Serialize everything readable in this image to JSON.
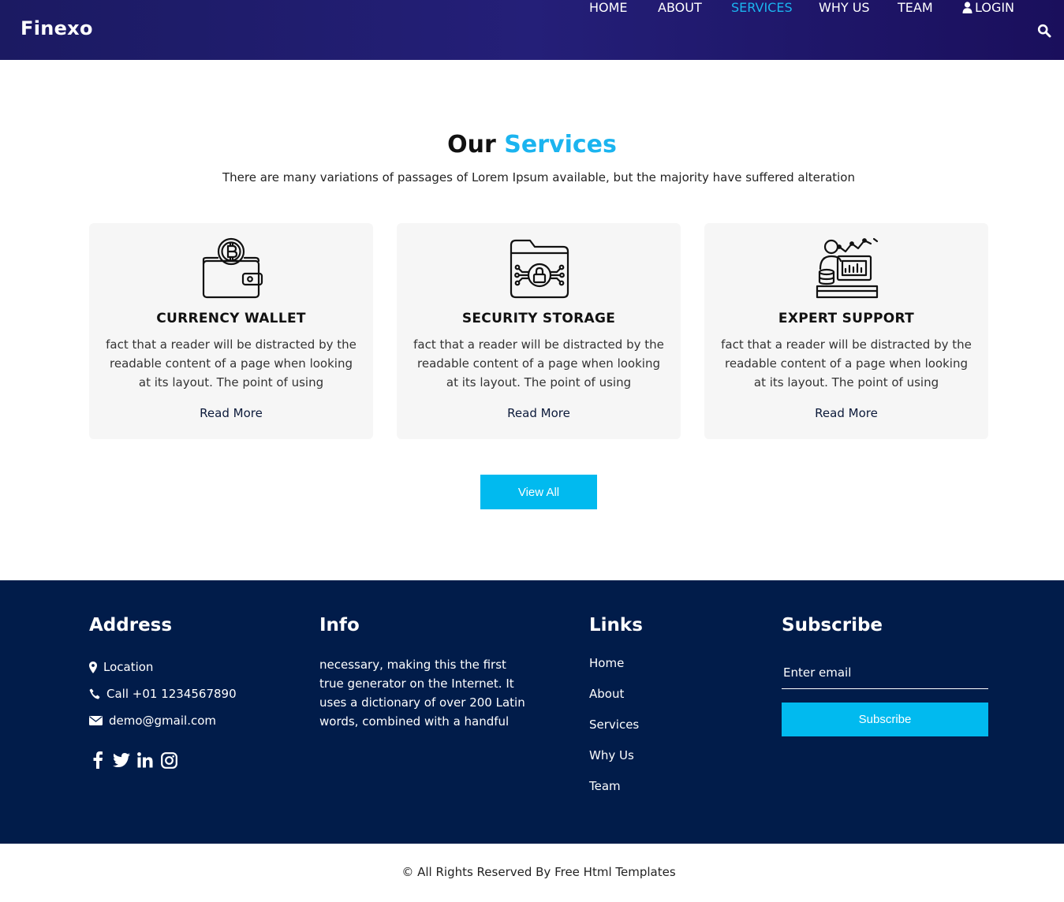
{
  "header": {
    "brand": "Finexo",
    "nav": [
      "HOME",
      "ABOUT",
      "SERVICES",
      "WHY US",
      "TEAM"
    ],
    "login_label": "LOGIN",
    "active": "SERVICES",
    "icons": {
      "login": "user-icon",
      "search": "search-icon"
    }
  },
  "services": {
    "title_part1": "Our",
    "title_part2": "Services",
    "subtitle": "There are many variations of passages of Lorem Ipsum available, but the majority have suffered alteration",
    "cards": [
      {
        "icon": "wallet-bitcoin-icon",
        "title": "CURRENCY WALLET",
        "text": "fact that a reader will be distracted by the readable content of a page when looking at its layout. The point of using",
        "link": "Read More"
      },
      {
        "icon": "secure-folder-icon",
        "title": "SECURITY STORAGE",
        "text": "fact that a reader will be distracted by the readable content of a page when looking at its layout. The point of using",
        "link": "Read More"
      },
      {
        "icon": "expert-support-icon",
        "title": "EXPERT SUPPORT",
        "text": "fact that a reader will be distracted by the readable content of a page when looking at its layout. The point of using",
        "link": "Read More"
      }
    ],
    "view_all": "View All"
  },
  "footer": {
    "address": {
      "heading": "Address",
      "location": "Location",
      "phone": "Call +01 1234567890",
      "email": "demo@gmail.com",
      "socials": [
        "facebook-icon",
        "twitter-icon",
        "linkedin-icon",
        "instagram-icon"
      ]
    },
    "info": {
      "heading": "Info",
      "text": "necessary, making this the first true generator on the Internet. It uses a dictionary of over 200 Latin words, combined with a handful"
    },
    "links": {
      "heading": "Links",
      "items": [
        "Home",
        "About",
        "Services",
        "Why Us",
        "Team"
      ]
    },
    "subscribe": {
      "heading": "Subscribe",
      "placeholder": "Enter email",
      "button": "Subscribe"
    }
  },
  "copyright": "© All Rights Reserved By Free Html Templates",
  "colors": {
    "accent": "#01baef",
    "header_bg": "#1b1a62",
    "footer_bg": "#011c4a",
    "card_bg": "#f6f6f6"
  }
}
